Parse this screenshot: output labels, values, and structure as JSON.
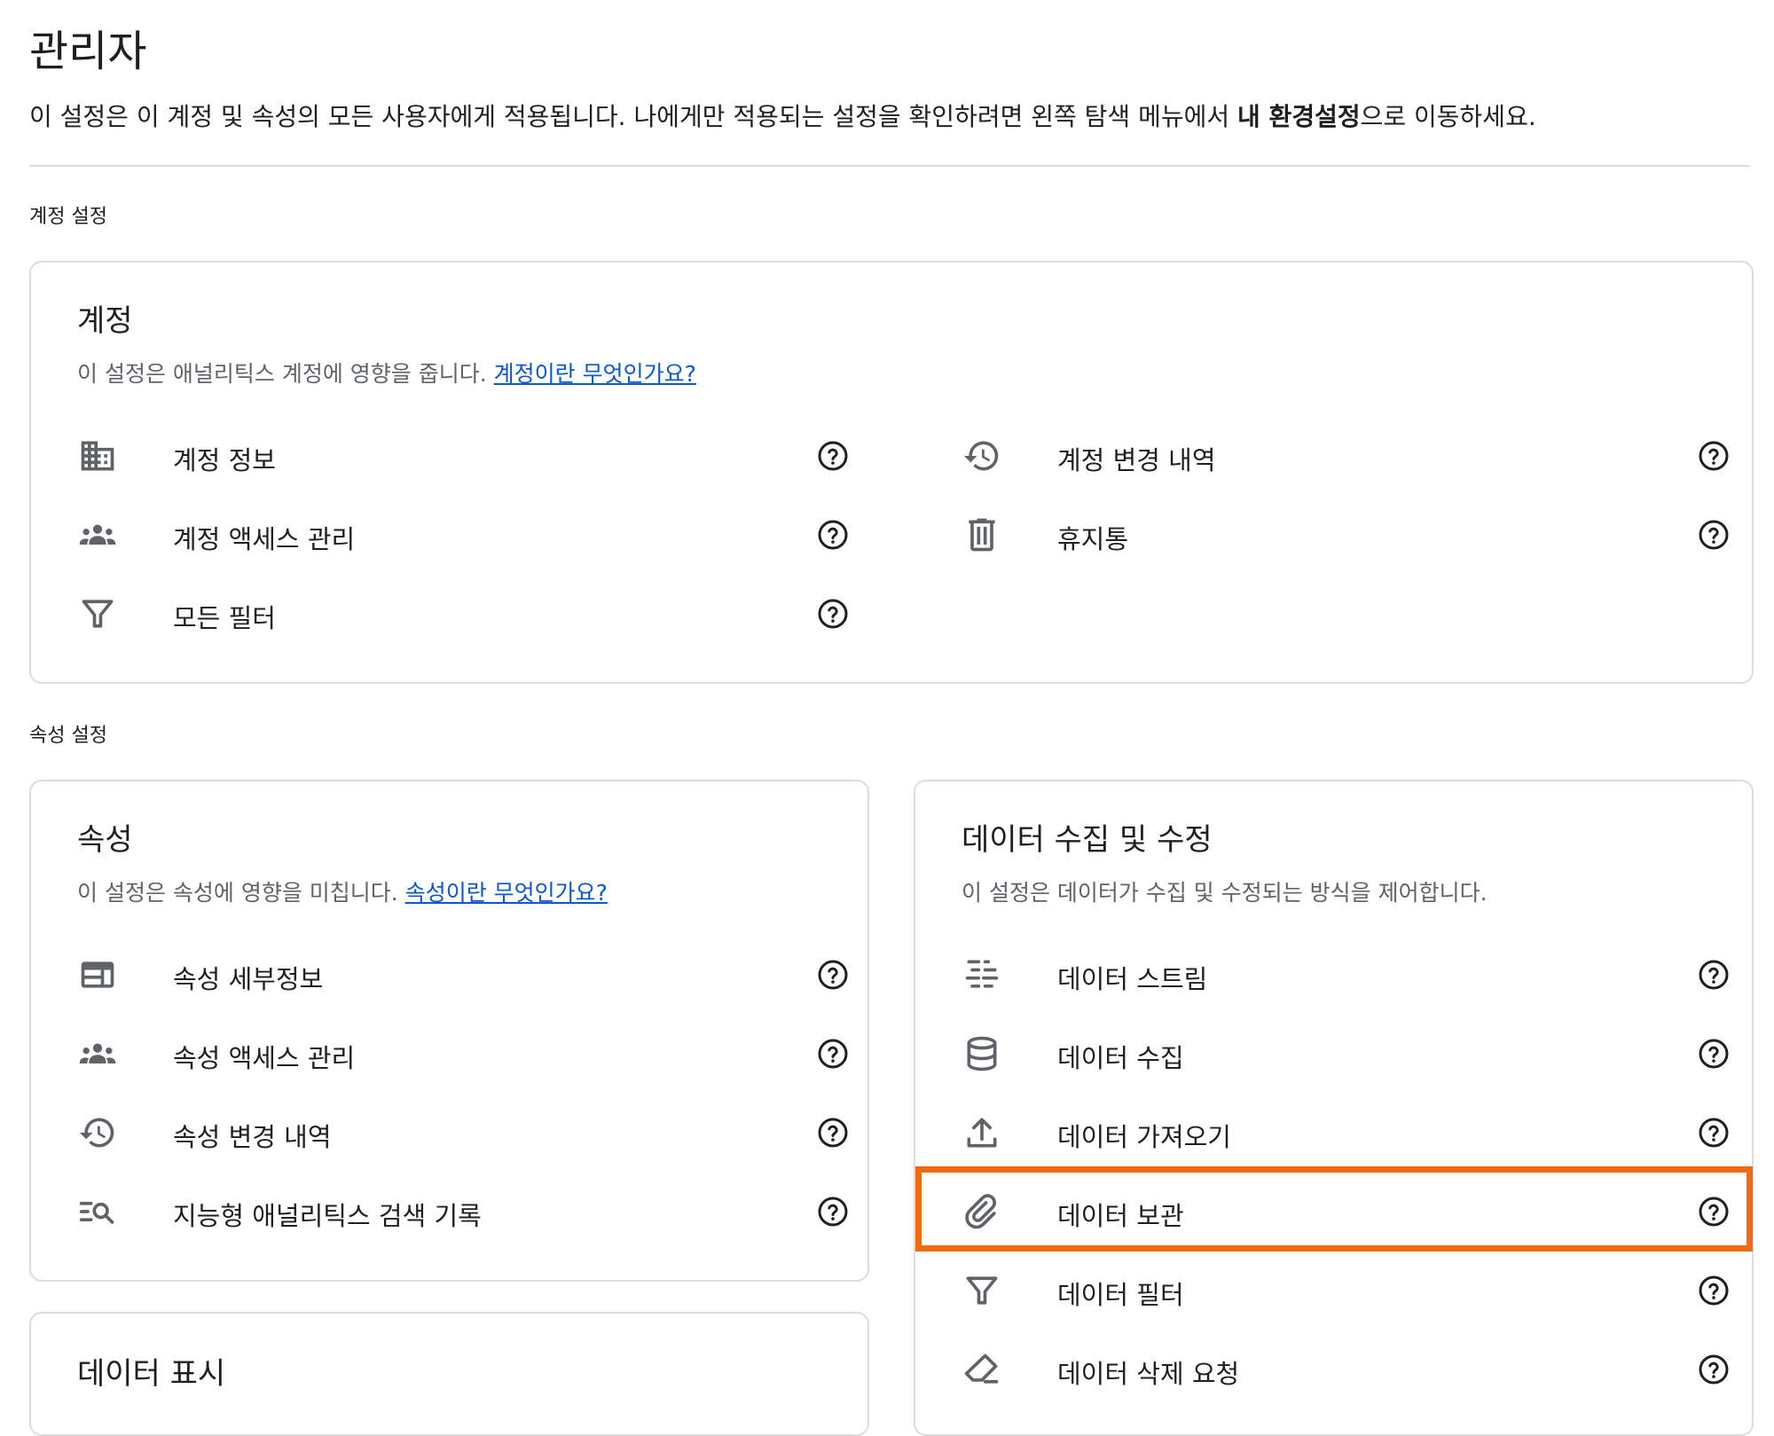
{
  "header": {
    "title": "관리자",
    "description_pre": "이 설정은 이 계정 및 속성의 모든 사용자에게 적용됩니다. 나에게만 적용되는 설정을 확인하려면 왼쪽 탐색 메뉴에서 ",
    "description_bold": "내 환경설정",
    "description_post": "으로 이동하세요."
  },
  "sections": {
    "account_settings_label": "계정 설정",
    "property_settings_label": "속성 설정"
  },
  "account_card": {
    "title": "계정",
    "description": "이 설정은 애널리틱스 계정에 영향을 줍니다. ",
    "link": "계정이란 무엇인가요?",
    "items": [
      {
        "label": "계정 정보",
        "icon": "building-icon"
      },
      {
        "label": "계정 액세스 관리",
        "icon": "group-icon"
      },
      {
        "label": "모든 필터",
        "icon": "filter-icon"
      },
      {
        "label": "계정 변경 내역",
        "icon": "history-icon"
      },
      {
        "label": "휴지통",
        "icon": "trash-icon"
      }
    ]
  },
  "property_card": {
    "title": "속성",
    "description": "이 설정은 속성에 영향을 미칩니다. ",
    "link": "속성이란 무엇인가요?",
    "items": [
      {
        "label": "속성 세부정보",
        "icon": "web-icon"
      },
      {
        "label": "속성 액세스 관리",
        "icon": "group-icon"
      },
      {
        "label": "속성 변경 내역",
        "icon": "history-icon"
      },
      {
        "label": "지능형 애널리틱스 검색 기록",
        "icon": "search-list-icon"
      }
    ]
  },
  "data_display_card": {
    "title": "데이터 표시"
  },
  "data_collection_card": {
    "title": "데이터 수집 및 수정",
    "description": "이 설정은 데이터가 수집 및 수정되는 방식을 제어합니다.",
    "items": [
      {
        "label": "데이터 스트림",
        "icon": "stream-icon"
      },
      {
        "label": "데이터 수집",
        "icon": "database-icon"
      },
      {
        "label": "데이터 가져오기",
        "icon": "upload-icon"
      },
      {
        "label": "데이터 보관",
        "icon": "storage-icon"
      },
      {
        "label": "데이터 필터",
        "icon": "filter-icon"
      },
      {
        "label": "데이터 삭제 요청",
        "icon": "eraser-icon"
      }
    ]
  },
  "colors": {
    "highlight": "#f26a0f",
    "link": "#0b57d0",
    "icon": "#5f6368"
  }
}
